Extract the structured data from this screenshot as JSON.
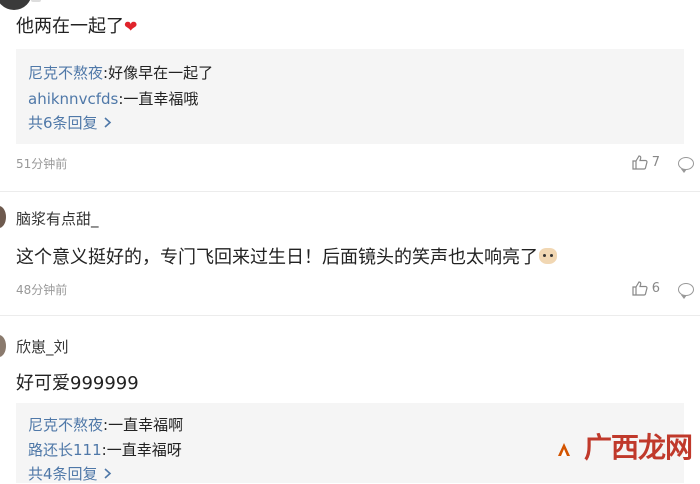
{
  "comments": [
    {
      "text": "他两在一起了",
      "heart": "❤",
      "replies": [
        {
          "user": "尼克不熬夜",
          "sep": ":",
          "text": "好像早在一起了"
        },
        {
          "user": "ahiknnvcfds",
          "sep": ":",
          "text": "一直幸福哦"
        }
      ],
      "more_replies": "共6条回复",
      "time": "51分钟前",
      "likes": "7"
    },
    {
      "username": "脑浆有点甜_",
      "text": "这个意义挺好的，专门飞回来过生日！后面镜头的笑声也太响亮了",
      "time": "48分钟前",
      "likes": "6"
    },
    {
      "username": "欣崽_刘",
      "text": "好可爱999999",
      "replies": [
        {
          "user": "尼克不熬夜",
          "sep": ":",
          "text": "一直幸福啊"
        },
        {
          "user": "路还长111",
          "sep": ":",
          "text": "一直幸福呀"
        }
      ],
      "more_replies": "共4条回复"
    }
  ],
  "icons": {
    "like": "thumbs-up-icon",
    "reply": "comment-bubble-icon",
    "chevron": "chevron-right-icon"
  },
  "colors": {
    "link": "#4f78a8",
    "heart": "#e0242c",
    "meta": "#999999",
    "reply_bg": "#f5f5f5"
  },
  "watermark": {
    "text": "广西龙网"
  }
}
